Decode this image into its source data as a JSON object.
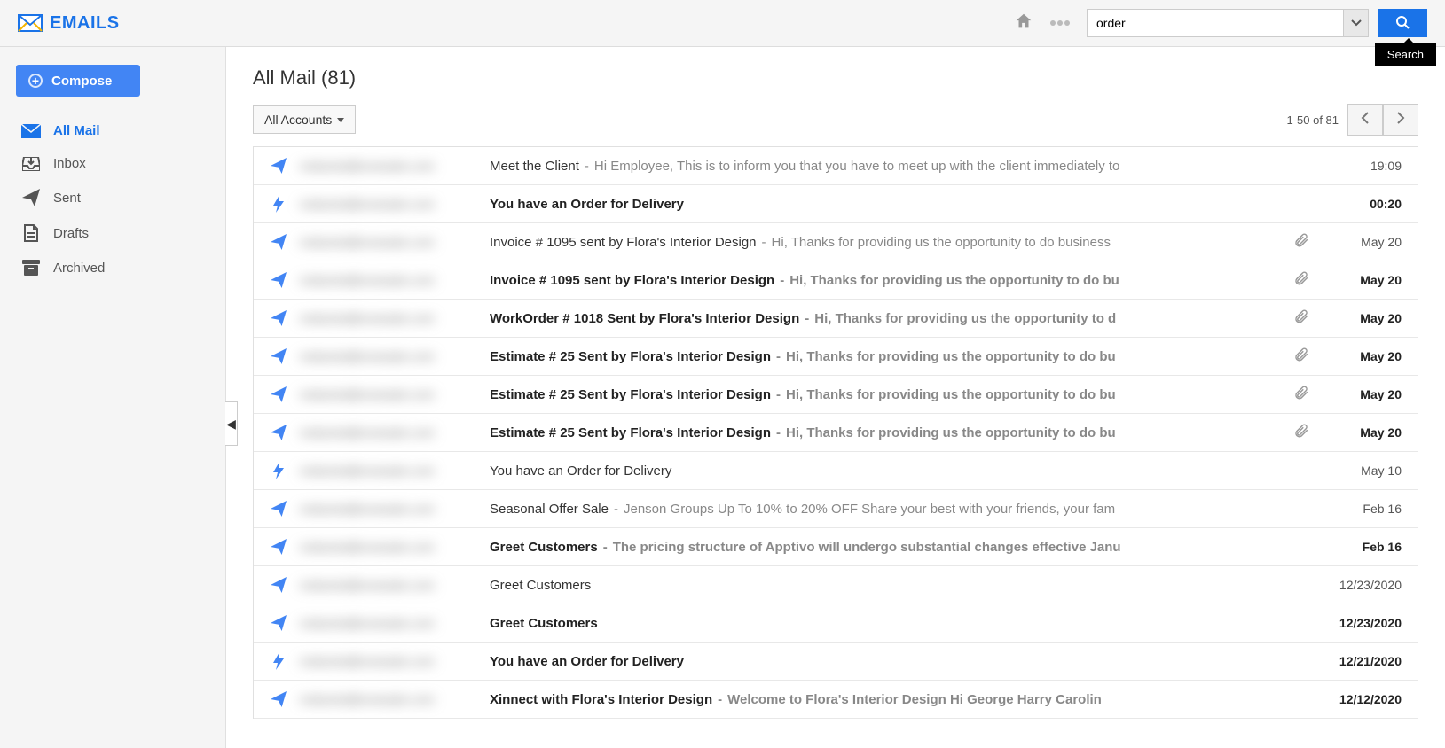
{
  "header": {
    "logo_text": "EMAILS",
    "search_value": "order",
    "tooltip": "Search"
  },
  "sidebar": {
    "compose_label": "Compose",
    "items": [
      {
        "label": "All Mail",
        "icon": "envelope",
        "active": true
      },
      {
        "label": "Inbox",
        "icon": "inbox",
        "active": false
      },
      {
        "label": "Sent",
        "icon": "send",
        "active": false
      },
      {
        "label": "Drafts",
        "icon": "draft",
        "active": false
      },
      {
        "label": "Archived",
        "icon": "archive",
        "active": false
      }
    ]
  },
  "main": {
    "title": "All Mail (81)",
    "accounts_label": "All Accounts",
    "pager_text": "1-50 of 81"
  },
  "rows": [
    {
      "icon": "send",
      "sender": "redacted@example.com",
      "subject": "Meet the Client",
      "preview": "Hi Employee, This is to inform you that you have to meet up with the client immediately to",
      "date": "19:09",
      "bold": false,
      "attach": false
    },
    {
      "icon": "bolt",
      "sender": "redacted@example.com",
      "subject": "You have an Order for Delivery",
      "preview": "",
      "date": "00:20",
      "bold": true,
      "attach": false
    },
    {
      "icon": "send",
      "sender": "redacted@example.com",
      "subject": "Invoice # 1095 sent by Flora's Interior Design",
      "preview": "Hi,  Thanks for providing us the opportunity to do business",
      "date": "May 20",
      "bold": false,
      "attach": true
    },
    {
      "icon": "send",
      "sender": "redacted@example.com",
      "subject": "Invoice # 1095 sent by Flora's Interior Design",
      "preview": "Hi,  Thanks for providing us the opportunity to do bu",
      "date": "May 20",
      "bold": true,
      "attach": true
    },
    {
      "icon": "send",
      "sender": "redacted@example.com",
      "subject": "WorkOrder # 1018 Sent by Flora's Interior Design",
      "preview": "Hi, Thanks for providing us the opportunity to d",
      "date": "May 20",
      "bold": true,
      "attach": true
    },
    {
      "icon": "send",
      "sender": "redacted@example.com",
      "subject": "Estimate # 25 Sent by Flora's Interior Design",
      "preview": "Hi,  Thanks for providing us the opportunity to do bu",
      "date": "May 20",
      "bold": true,
      "attach": true
    },
    {
      "icon": "send",
      "sender": "redacted@example.com",
      "subject": "Estimate # 25 Sent by Flora's Interior Design",
      "preview": "Hi,  Thanks for providing us the opportunity to do bu",
      "date": "May 20",
      "bold": true,
      "attach": true
    },
    {
      "icon": "send",
      "sender": "redacted@example.com",
      "subject": "Estimate # 25 Sent by Flora's Interior Design",
      "preview": "Hi,  Thanks for providing us the opportunity to do bu",
      "date": "May 20",
      "bold": true,
      "attach": true
    },
    {
      "icon": "bolt",
      "sender": "redacted@example.com",
      "subject": "You have an Order for Delivery",
      "preview": "",
      "date": "May 10",
      "bold": false,
      "attach": false
    },
    {
      "icon": "send",
      "sender": "redacted@example.com",
      "subject": "Seasonal Offer Sale",
      "preview": "Jenson Groups Up To 10% to 20% OFF Share your best with your friends, your fam",
      "date": "Feb 16",
      "bold": false,
      "attach": false
    },
    {
      "icon": "send",
      "sender": "redacted@example.com",
      "subject": "Greet Customers",
      "preview": "The pricing structure of Apptivo will undergo substantial changes effective Janu",
      "date": "Feb 16",
      "bold": true,
      "attach": false
    },
    {
      "icon": "send",
      "sender": "redacted@example.com",
      "subject": "Greet Customers",
      "preview": "",
      "date": "12/23/2020",
      "bold": false,
      "attach": false
    },
    {
      "icon": "send",
      "sender": "redacted@example.com",
      "subject": "Greet Customers",
      "preview": "",
      "date": "12/23/2020",
      "bold": true,
      "attach": false
    },
    {
      "icon": "bolt",
      "sender": "redacted@example.com",
      "subject": "You have an Order for Delivery",
      "preview": "",
      "date": "12/21/2020",
      "bold": true,
      "attach": false
    },
    {
      "icon": "send",
      "sender": "redacted@example.com",
      "subject": "Xinnect with Flora's Interior Design",
      "preview": " Welcome to Flora's Interior Design   Hi George Harry Carolin",
      "date": "12/12/2020",
      "bold": true,
      "attach": false
    }
  ]
}
